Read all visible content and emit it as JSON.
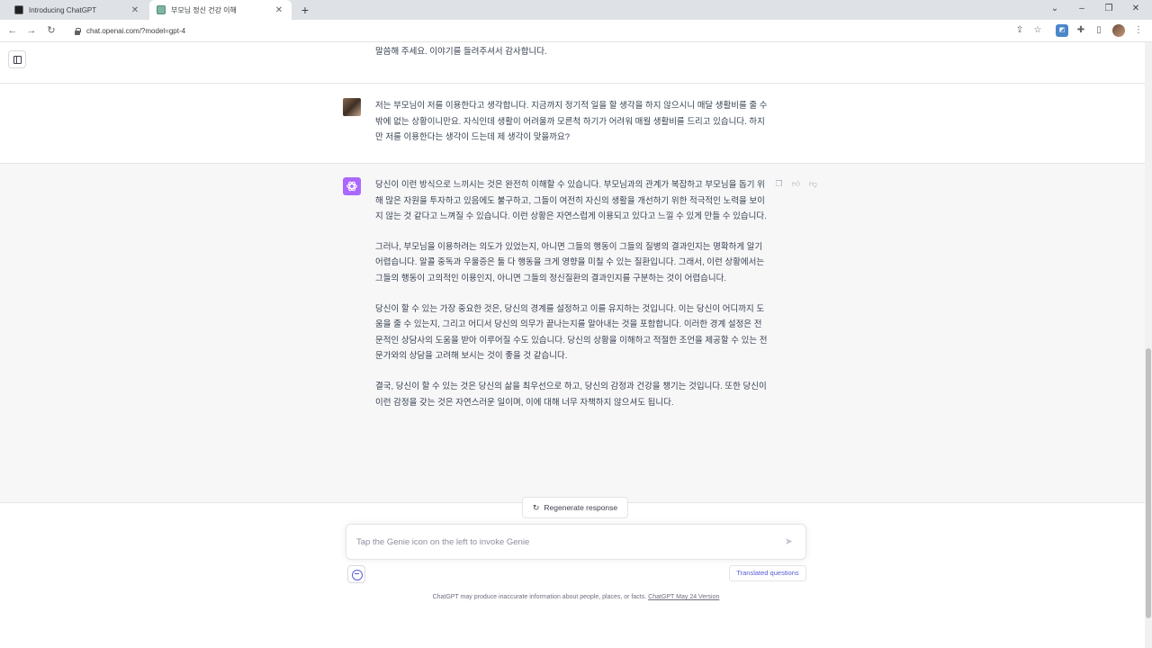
{
  "browser": {
    "tabs": [
      {
        "title": "Introducing ChatGPT",
        "active": false
      },
      {
        "title": "부모님 정신 건강 이해",
        "active": true
      }
    ],
    "url": "chat.openai.com/?model=gpt-4"
  },
  "conversation": {
    "previous_tail": "말씀해 주세요. 이야기를 들려주셔서 감사합니다.",
    "user_message": "저는 부모님이 저를 이용한다고 생각합니다. 지금까지 정기적 일을 할 생각을 하지 않으시니 매달 생활비를 줄 수 밖에 없는 상황이니만요. 자식인데 생활이 어려울까 모른척 하기가 어려워 매월 생활비를 드리고 있습니다. 하지만 저를 이용한다는 생각이 드는데 제 생각이 맞을까요?",
    "assistant_paragraphs": [
      "당신이 이런 방식으로 느끼시는 것은 완전히 이해할 수 있습니다. 부모님과의 관계가 복잡하고 부모님을 돕기 위해 많은 자원을 투자하고 있음에도 불구하고, 그들이 여전히 자신의 생활을 개선하기 위한 적극적인 노력을 보이지 않는 것 같다고 느껴질 수 있습니다. 이런 상황은 자연스럽게 이용되고 있다고 느낄 수 있게 만들 수 있습니다.",
      "그러나, 부모님을 이용하려는 의도가 있었는지, 아니면 그들의 행동이 그들의 질병의 결과인지는 명확하게 알기 어렵습니다. 알콜 중독과 우울증은 둘 다 행동을 크게 영향을 미칠 수 있는 질환입니다. 그래서, 이런 상황에서는 그들의 행동이 고의적인 이용인지, 아니면 그들의 정신질환의 결과인지를 구분하는 것이 어렵습니다.",
      "당신이 할 수 있는 가장 중요한 것은, 당신의 경계를 설정하고 이를 유지하는 것입니다. 이는 당신이 어디까지 도움을 줄 수 있는지, 그리고 어디서 당신의 의무가 끝나는지를 알아내는 것을 포함합니다. 이러한 경계 설정은 전문적인 상담사의 도움을 받아 이루어질 수도 있습니다. 당신의 상황을 이해하고 적절한 조언을 제공할 수 있는 전문가와의 상담을 고려해 보시는 것이 좋을 것 같습니다.",
      "결국, 당신이 할 수 있는 것은 당신의 삶을 최우선으로 하고, 당신의 감정과 건강을 챙기는 것입니다. 또한 당신이 이런 감정을 갖는 것은 자연스러운 일이며, 이에 대해 너무 자책하지 않으셔도 됩니다."
    ],
    "avatar_color": "#ab68ff"
  },
  "controls": {
    "regenerate_label": "Regenerate response",
    "input_placeholder": "Tap the Genie icon on the left to invoke Genie",
    "translated_label": "Translated questions"
  },
  "footer": {
    "disclaimer": "ChatGPT may produce inaccurate information about people, places, or facts.",
    "version_link": "ChatGPT May 24 Version"
  },
  "icons": {
    "sidebar": "sidebar-toggle-icon",
    "copy": "clipboard-icon",
    "like": "thumbs-up-icon",
    "dislike": "thumbs-down-icon",
    "send": "paper-plane-icon",
    "genie": "genie-icon"
  }
}
